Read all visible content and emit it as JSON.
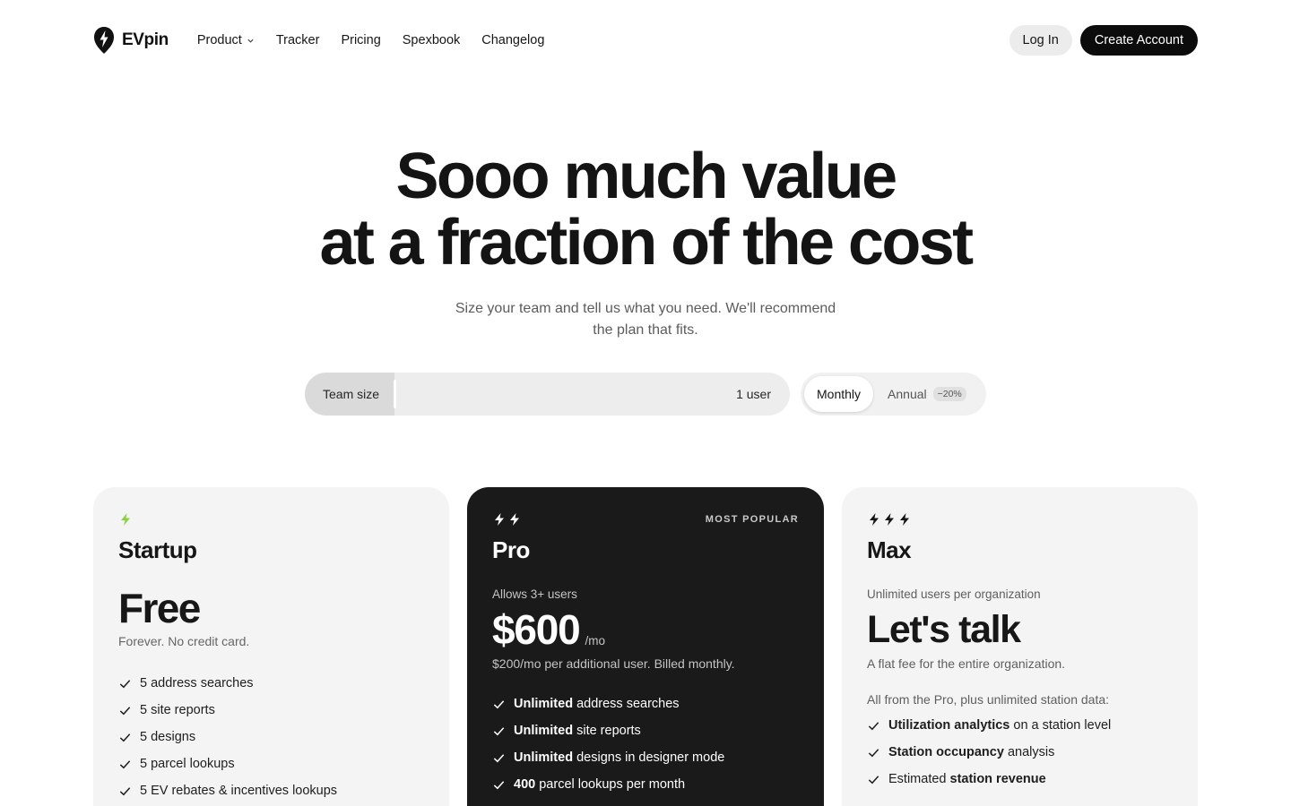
{
  "nav": {
    "brand": "EVpin",
    "links": [
      {
        "label": "Product",
        "has_dropdown": true
      },
      {
        "label": "Tracker"
      },
      {
        "label": "Pricing"
      },
      {
        "label": "Spexbook"
      },
      {
        "label": "Changelog"
      }
    ],
    "login_label": "Log In",
    "create_label": "Create Account"
  },
  "hero": {
    "title_line1": "Sooo much value",
    "title_line2": "at a fraction of the cost",
    "subtitle_line1": "Size your team and tell us what you need. We'll recommend",
    "subtitle_line2": "the plan that fits."
  },
  "controls": {
    "team_size_label": "Team size",
    "team_size_value": "1 user",
    "billing_monthly": "Monthly",
    "billing_annual": "Annual",
    "annual_discount": "−20%"
  },
  "plans": {
    "startup": {
      "name": "Startup",
      "price": "Free",
      "price_note": "Forever. No credit card.",
      "features": [
        "5 address searches",
        "5 site reports",
        "5 designs",
        "5 parcel lookups",
        "5 EV rebates & incentives lookups"
      ]
    },
    "pro": {
      "badge": "MOST POPULAR",
      "name": "Pro",
      "users_note": "Allows 3+ users",
      "price": "$600",
      "per": "/mo",
      "price_note": "$200/mo per additional user. Billed monthly.",
      "features": [
        {
          "strong": "Unlimited",
          "rest": " address searches"
        },
        {
          "strong": "Unlimited",
          "rest": " site reports"
        },
        {
          "strong": "Unlimited",
          "rest": " designs in designer mode"
        },
        {
          "strong": "400",
          "rest": " parcel lookups per month"
        }
      ]
    },
    "max": {
      "name": "Max",
      "users_note": "Unlimited users per organization",
      "price": "Let's talk",
      "price_note": "A flat fee for the entire organization.",
      "plus_note": "All from the Pro, plus unlimited station data:",
      "features": [
        {
          "strong": "Utilization analytics",
          "rest": " on a station level"
        },
        {
          "strong": "Station occupancy",
          "rest": " analysis"
        },
        {
          "strong": "",
          "rest": "Estimated "
        },
        {
          "strong": "station revenue",
          "rest": ""
        }
      ]
    }
  },
  "colors": {
    "accent_green": "#8bd13f",
    "dark_card": "#1a1a1a",
    "light_card": "#f4f4f4",
    "button_dark": "#0c0c0c"
  }
}
